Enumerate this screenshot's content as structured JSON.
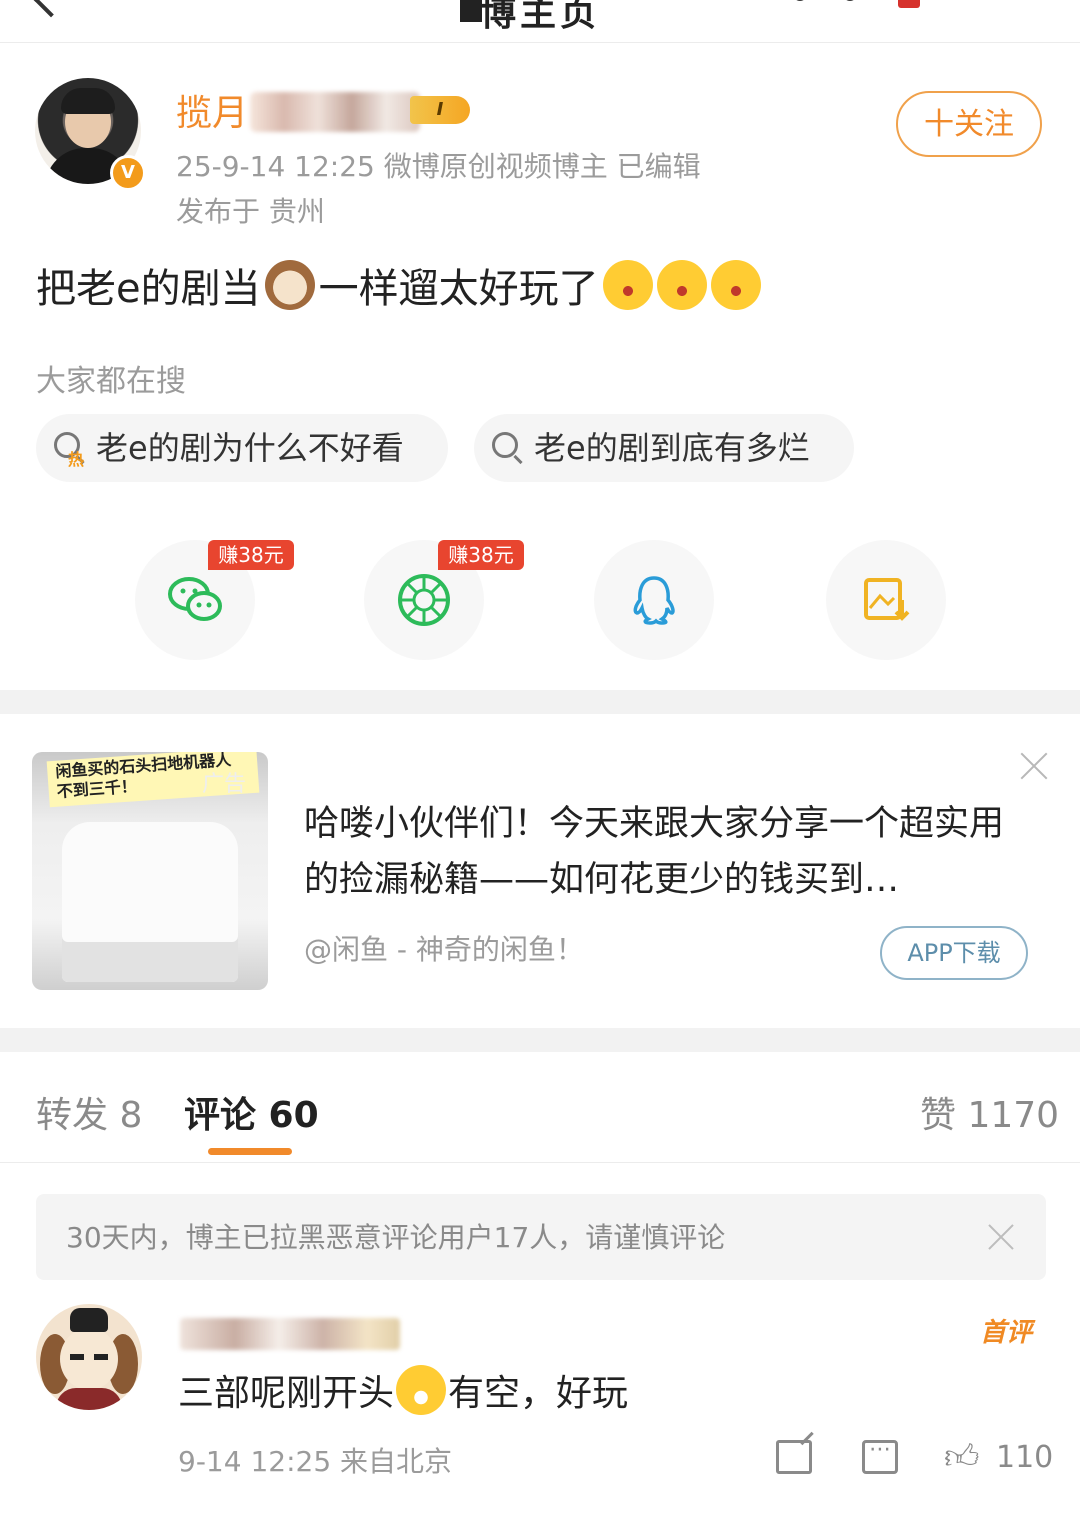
{
  "top_bar": {
    "title": "博主页",
    "back_icon": "chevron-left-icon"
  },
  "author": {
    "name": "揽月",
    "level": "I",
    "verified_icon": "v-verified-icon",
    "meta": "25-9-14 12:25  微博原创视频博主  已编辑",
    "location": "发布于 贵州",
    "follow_label": "十关注"
  },
  "post": {
    "text_parts": [
      "把老e的剧当",
      "一样遛太好玩了"
    ],
    "emojis": [
      "dog-emoji",
      "shocked-emoji",
      "shocked-emoji",
      "shocked-emoji"
    ]
  },
  "search": {
    "heading": "大家都在搜",
    "hot_mark": "热",
    "chips": [
      "老e的剧为什么不好看",
      "老e的剧到底有多烂"
    ]
  },
  "share": {
    "earn_label": "赚38元",
    "targets": [
      {
        "icon": "wechat-icon",
        "earn": true
      },
      {
        "icon": "moments-icon",
        "earn": true
      },
      {
        "icon": "qq-icon",
        "earn": false
      },
      {
        "icon": "save-image-icon",
        "earn": false
      }
    ]
  },
  "ad": {
    "image_banner": "闲鱼买的石头扫地机器人\n不到三千！",
    "image_label": "广告",
    "text": "哈喽小伙伴们！今天来跟大家分享一个超实用的捡漏秘籍——如何花更少的钱买到…",
    "source": "@闲鱼 - 神奇的闲鱼！",
    "button": "APP下载"
  },
  "tabs": {
    "repost": "转发 8",
    "comment": "评论 60",
    "like": "赞 1170"
  },
  "notice": "30天内，博主已拉黑恶意评论用户17人，请谨慎评论",
  "comment": {
    "badge": "首评",
    "text_parts": [
      "三部呢刚开头",
      "有空，好玩"
    ],
    "emoji": "grin-emoji",
    "meta": "9-14 12:25  来自北京",
    "like_count": "110"
  },
  "colors": {
    "accent": "#f18a2b",
    "earn_red": "#e8452f",
    "wechat_green": "#2dbb5a",
    "qq_blue": "#2a9cd8",
    "gallery_yellow": "#f0b323"
  }
}
